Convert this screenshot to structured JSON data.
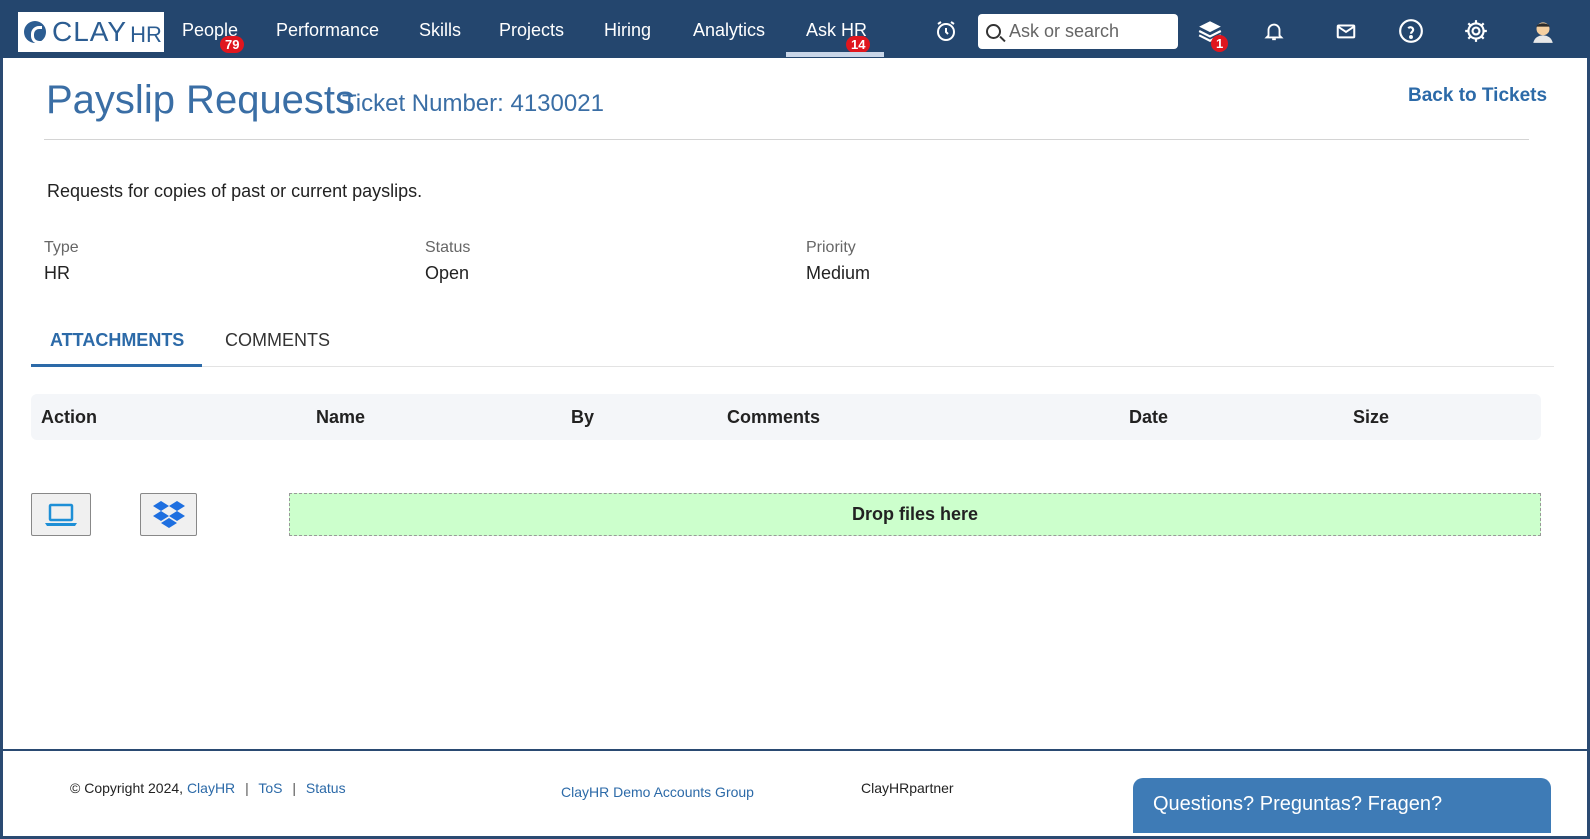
{
  "brand": {
    "name_main": "CLAY",
    "name_suffix": "HR"
  },
  "nav": {
    "people": {
      "label": "People",
      "badge": "79"
    },
    "performance": "Performance",
    "skills": "Skills",
    "projects": "Projects",
    "hiring": "Hiring",
    "analytics": "Analytics",
    "askhr": {
      "label": "Ask HR",
      "badge": "14"
    }
  },
  "search": {
    "placeholder": "Ask or search"
  },
  "icons": {
    "alarm": "alarm-clock-icon",
    "layers": "layers-icon",
    "layers_badge": "1",
    "bell": "bell-icon",
    "mail": "mail-icon",
    "help": "help-circle-icon",
    "settings": "gear-icon",
    "avatar": "user-avatar-icon"
  },
  "page": {
    "title": "Payslip Requests",
    "ticket": "Ticket Number: 4130021",
    "back_link": "Back to Tickets",
    "description": "Requests for copies of past or current payslips."
  },
  "meta": {
    "type_label": "Type",
    "type_value": "HR",
    "status_label": "Status",
    "status_value": "Open",
    "priority_label": "Priority",
    "priority_value": "Medium"
  },
  "tabs": {
    "attachments": "ATTACHMENTS",
    "comments": "COMMENTS"
  },
  "table": {
    "columns": [
      "Action",
      "Name",
      "By",
      "Comments",
      "Date",
      "Size"
    ]
  },
  "upload": {
    "computer_icon": "laptop-icon",
    "dropbox_icon": "dropbox-icon",
    "dropzone": "Drop files here"
  },
  "footer": {
    "copyright": "© Copyright 2024,",
    "clayhr_link": "ClayHR",
    "tos": "ToS",
    "status": "Status",
    "group": "ClayHR Demo Accounts Group",
    "partner": "ClayHRpartner",
    "chat": "Questions? Preguntas? Fragen?"
  },
  "colors": {
    "navbar": "#24466e",
    "accent": "#2c6aa8",
    "badge": "#e0161e",
    "dropzone": "#ccffcc"
  }
}
